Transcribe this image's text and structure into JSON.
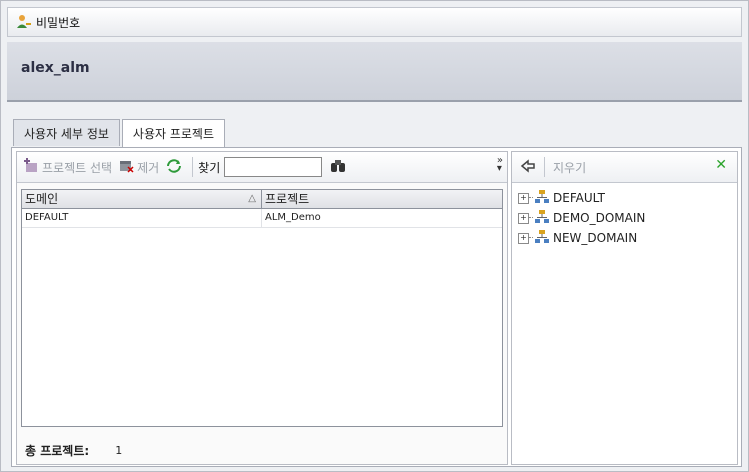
{
  "window": {
    "title": "비밀번호"
  },
  "user": {
    "name": "alex_alm"
  },
  "tabs": [
    {
      "label": "사용자 세부 정보",
      "active": false
    },
    {
      "label": "사용자 프로젝트",
      "active": true
    }
  ],
  "toolbar": {
    "select_project_label": "프로젝트 선택",
    "remove_label": "제거",
    "find_label": "찾기",
    "find_value": ""
  },
  "grid": {
    "headers": [
      "도메인",
      "프로젝트"
    ],
    "sort_indicator": "△",
    "rows": [
      {
        "domain": "DEFAULT",
        "project": "ALM_Demo"
      }
    ]
  },
  "footer": {
    "total_label": "총 프로젝트:",
    "total_count": "1"
  },
  "right_panel": {
    "clear_label": "지우기",
    "tree": [
      {
        "label": "DEFAULT"
      },
      {
        "label": "DEMO_DOMAIN"
      },
      {
        "label": "NEW_DOMAIN"
      }
    ]
  },
  "icons": {
    "title": "user-key-icon",
    "select_project": "add-project-icon",
    "remove": "remove-icon",
    "refresh": "refresh-icon",
    "find": "binoculars-icon",
    "more": "chevron-double-right-icon",
    "back": "arrow-left-icon",
    "clear": "close-icon",
    "domain": "domain-icon"
  },
  "colors": {
    "clear_x": "#2aa32a",
    "user_bar": "#cdd1da"
  }
}
